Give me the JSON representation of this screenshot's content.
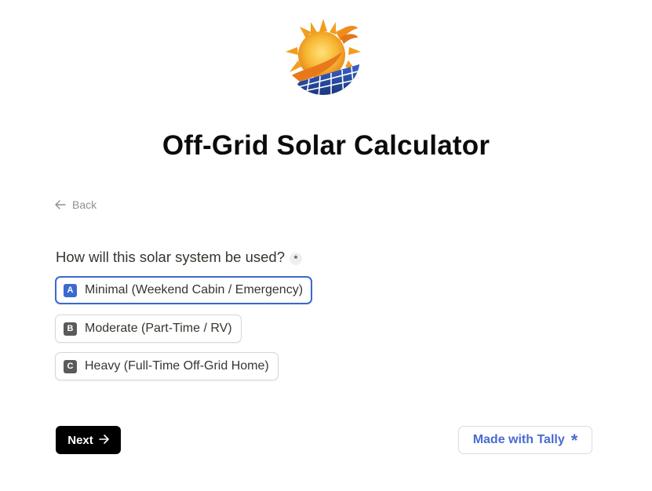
{
  "form": {
    "title": "Off-Grid Solar Calculator",
    "back_label": "Back",
    "question": "How will this solar system be used?",
    "required_mark": "*",
    "options": [
      {
        "key": "A",
        "label": "Minimal (Weekend Cabin / Emergency)",
        "selected": true
      },
      {
        "key": "B",
        "label": "Moderate (Part-Time / RV)",
        "selected": false
      },
      {
        "key": "C",
        "label": "Heavy (Full-Time Off-Grid Home)",
        "selected": false
      }
    ],
    "next_label": "Next",
    "branding_label": "Made with Tally",
    "branding_icon": "*"
  },
  "icons": {
    "logo": "sun-solar-panel-logo",
    "back": "arrow-left-icon",
    "next": "arrow-right-icon",
    "tally": "asterisk-icon"
  },
  "colors": {
    "accent": "#3c69d0",
    "tally": "#4a6ad0",
    "next_bg": "#000000",
    "sun": "#f4a623",
    "panel": "#1f3f8f"
  }
}
